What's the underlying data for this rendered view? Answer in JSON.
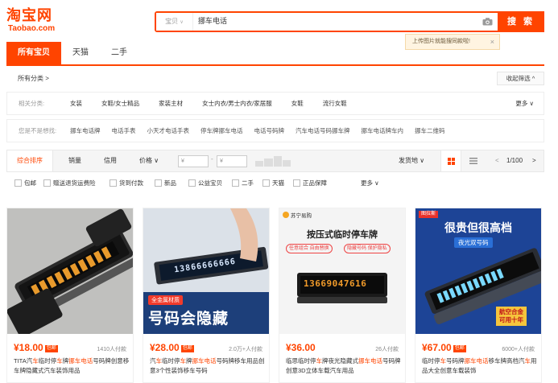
{
  "logo": {
    "cn": "淘宝网",
    "en": "Taobao.com"
  },
  "search": {
    "type_label": "宝贝",
    "query": "挪车电话",
    "button": "搜 索",
    "tooltip": "上传图片就能搜同款啦!",
    "tooltip_close": "×"
  },
  "tabs": [
    {
      "label": "所有宝贝",
      "active": true
    },
    {
      "label": "天猫",
      "active": false
    },
    {
      "label": "二手",
      "active": false
    }
  ],
  "breadcrumb": "所有分类 >",
  "collapse_label": "收起筛选 ^",
  "related": {
    "label": "相关分类:",
    "items": [
      "女装",
      "女鞋/女士精品",
      "家装主材",
      "女士内衣/男士内衣/家居服",
      "女鞋",
      "流行女鞋"
    ],
    "more": "更多 ∨"
  },
  "suggest": {
    "label": "您是不是想找:",
    "items": [
      "挪车电话牌",
      "电话手表",
      "小天才电话手表",
      "停车牌挪车电话",
      "电话号码牌",
      "汽车电话号码挪车牌",
      "挪车电话牌车内",
      "挪车二维码"
    ]
  },
  "sort": {
    "items": [
      "综合排序",
      "销量",
      "信用",
      "价格 ∨"
    ],
    "price_from": "¥",
    "price_to": "¥",
    "ship_from": "发货地 ∨",
    "page": "1/100"
  },
  "filters": [
    "包邮",
    "赠送退货运费险",
    "货到付款",
    "新品",
    "公益宝贝",
    "二手",
    "天猫",
    "正品保障",
    "更多 ∨"
  ],
  "products": [
    {
      "price": "¥18.00",
      "badge": "包邮",
      "sold": "1410人付款",
      "title_pre": "TITA汽",
      "title_hl1": "车",
      "title_mid": "临时停",
      "title_hl2": "车",
      "title_mid2": "牌",
      "title_hl3": "挪车电话",
      "title_rest": "号码牌创意移车牌隐藏式汽车装饰用品"
    },
    {
      "price": "¥28.00",
      "badge": "包邮",
      "sold": "2.0万+人付款",
      "title_pre": "汽",
      "title_hl1": "车",
      "title_mid": "临时停",
      "title_hl2": "车",
      "title_mid2": "牌",
      "title_hl3": "挪车电话",
      "title_rest": "号码牌移车用品创意3个性装饰移车号码",
      "img_tag": "全金属材质",
      "img_text": "号码会隐藏",
      "plate_digits": "13866666666"
    },
    {
      "price": "¥36.00",
      "badge": "",
      "sold": "26人付款",
      "title_pre": "临思临时停",
      "title_hl1": "车",
      "title_mid": "牌夜光隐藏式",
      "title_hl2": "挪车电话",
      "title_mid2": "号码",
      "title_hl3": "",
      "title_rest": "牌创意3D立体车载汽车用品",
      "store_tag": "苏宁易购",
      "img_heading": "按压式临时停车牌",
      "img_tag1": "任意组合 自由替换",
      "img_tag2": "隐藏号码 保护隐私",
      "plate_digits": "13669047616"
    },
    {
      "price": "¥67.00",
      "badge": "包邮",
      "sold": "6000+人付款",
      "title_pre": "临时停",
      "title_hl1": "车",
      "title_mid": "号码牌",
      "title_hl2": "挪车电话",
      "title_mid2": "移车牌高档汽",
      "title_hl3": "车",
      "title_rest": "用品大全创意车载装饰",
      "img_brand": "图拉斯",
      "img_heading": "很贵但很高档",
      "img_sub": "夜光双号码",
      "img_foot1": "航空合金",
      "img_foot2": "可用十年"
    }
  ],
  "colors": {
    "accent": "#ff4400",
    "tooltip_bg": "#fff4e1"
  }
}
